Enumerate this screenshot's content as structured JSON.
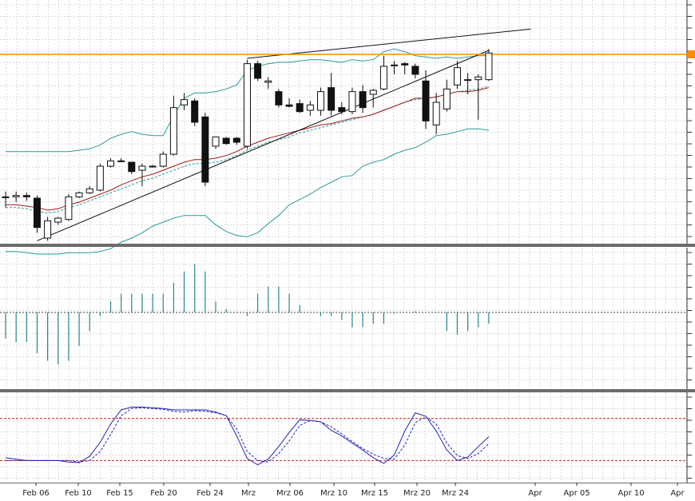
{
  "chart_data": [
    {
      "type": "candlestick",
      "panel": "price",
      "grid": true,
      "candles": [
        {
          "date": "Feb 01",
          "o": 0.474,
          "h": 0.478,
          "l": 0.466,
          "c": 0.474
        },
        {
          "date": "Feb 02",
          "o": 0.474,
          "h": 0.478,
          "l": 0.47,
          "c": 0.475
        },
        {
          "date": "Feb 03",
          "o": 0.475,
          "h": 0.477,
          "l": 0.471,
          "c": 0.474
        },
        {
          "date": "Feb 06",
          "o": 0.473,
          "h": 0.475,
          "l": 0.447,
          "c": 0.451
        },
        {
          "date": "Feb 07",
          "o": 0.443,
          "h": 0.459,
          "l": 0.441,
          "c": 0.456
        },
        {
          "date": "Feb 08",
          "o": 0.455,
          "h": 0.459,
          "l": 0.453,
          "c": 0.458
        },
        {
          "date": "Feb 09",
          "o": 0.457,
          "h": 0.476,
          "l": 0.456,
          "c": 0.474
        },
        {
          "date": "Feb 10",
          "o": 0.474,
          "h": 0.478,
          "l": 0.473,
          "c": 0.477
        },
        {
          "date": "Feb 13",
          "o": 0.477,
          "h": 0.482,
          "l": 0.476,
          "c": 0.48
        },
        {
          "date": "Feb 14",
          "o": 0.479,
          "h": 0.499,
          "l": 0.478,
          "c": 0.497
        },
        {
          "date": "Feb 15",
          "o": 0.497,
          "h": 0.503,
          "l": 0.496,
          "c": 0.501
        },
        {
          "date": "Feb 16",
          "o": 0.501,
          "h": 0.503,
          "l": 0.5,
          "c": 0.501
        },
        {
          "date": "Feb 17",
          "o": 0.5,
          "h": 0.5,
          "l": 0.491,
          "c": 0.493
        },
        {
          "date": "Feb 18",
          "o": 0.494,
          "h": 0.499,
          "l": 0.482,
          "c": 0.497
        },
        {
          "date": "Feb 19",
          "o": 0.497,
          "h": 0.498,
          "l": 0.496,
          "c": 0.497
        },
        {
          "date": "Feb 20",
          "o": 0.497,
          "h": 0.508,
          "l": 0.496,
          "c": 0.506
        },
        {
          "date": "Feb 21",
          "o": 0.506,
          "h": 0.55,
          "l": 0.505,
          "c": 0.541
        },
        {
          "date": "Feb 22",
          "o": 0.543,
          "h": 0.552,
          "l": 0.539,
          "c": 0.547
        },
        {
          "date": "Feb 23",
          "o": 0.546,
          "h": 0.548,
          "l": 0.527,
          "c": 0.53
        },
        {
          "date": "Feb 24",
          "o": 0.534,
          "h": 0.537,
          "l": 0.482,
          "c": 0.485
        },
        {
          "date": "Feb 27",
          "o": 0.512,
          "h": 0.519,
          "l": 0.51,
          "c": 0.519
        },
        {
          "date": "Feb 28",
          "o": 0.518,
          "h": 0.519,
          "l": 0.513,
          "c": 0.514
        },
        {
          "date": "Feb 29",
          "o": 0.518,
          "h": 0.519,
          "l": 0.513,
          "c": 0.515
        },
        {
          "date": "Mrz 01",
          "o": 0.512,
          "h": 0.577,
          "l": 0.51,
          "c": 0.574
        },
        {
          "date": "Mrz 02",
          "o": 0.574,
          "h": 0.576,
          "l": 0.561,
          "c": 0.563
        },
        {
          "date": "Mrz 05",
          "o": 0.56,
          "h": 0.564,
          "l": 0.555,
          "c": 0.561
        },
        {
          "date": "Mrz 06",
          "o": 0.553,
          "h": 0.555,
          "l": 0.541,
          "c": 0.543
        },
        {
          "date": "Mrz 07",
          "o": 0.543,
          "h": 0.548,
          "l": 0.541,
          "c": 0.542
        },
        {
          "date": "Mrz 08",
          "o": 0.544,
          "h": 0.547,
          "l": 0.537,
          "c": 0.538
        },
        {
          "date": "Mrz 09",
          "o": 0.539,
          "h": 0.546,
          "l": 0.535,
          "c": 0.543
        },
        {
          "date": "Mrz 12",
          "o": 0.539,
          "h": 0.556,
          "l": 0.535,
          "c": 0.553
        },
        {
          "date": "Mrz 13",
          "o": 0.556,
          "h": 0.567,
          "l": 0.535,
          "c": 0.539
        },
        {
          "date": "Mrz 14",
          "o": 0.541,
          "h": 0.545,
          "l": 0.536,
          "c": 0.538
        },
        {
          "date": "Mrz 15",
          "o": 0.538,
          "h": 0.556,
          "l": 0.536,
          "c": 0.553
        },
        {
          "date": "Mrz 16",
          "o": 0.553,
          "h": 0.558,
          "l": 0.537,
          "c": 0.541
        },
        {
          "date": "Mrz 19",
          "o": 0.551,
          "h": 0.555,
          "l": 0.541,
          "c": 0.554
        },
        {
          "date": "Mrz 20",
          "o": 0.555,
          "h": 0.58,
          "l": 0.554,
          "c": 0.572
        },
        {
          "date": "Mrz 21",
          "o": 0.573,
          "h": 0.576,
          "l": 0.566,
          "c": 0.573
        },
        {
          "date": "Mrz 22",
          "o": 0.574,
          "h": 0.575,
          "l": 0.566,
          "c": 0.573
        },
        {
          "date": "Mrz 23",
          "o": 0.572,
          "h": 0.574,
          "l": 0.563,
          "c": 0.566
        },
        {
          "date": "Mrz 26",
          "o": 0.561,
          "h": 0.569,
          "l": 0.525,
          "c": 0.531
        },
        {
          "date": "Mrz 27",
          "o": 0.528,
          "h": 0.552,
          "l": 0.521,
          "c": 0.545
        },
        {
          "date": "Mrz 28",
          "o": 0.54,
          "h": 0.562,
          "l": 0.538,
          "c": 0.555
        },
        {
          "date": "Mrz 29",
          "o": 0.558,
          "h": 0.576,
          "l": 0.555,
          "c": 0.571
        },
        {
          "date": "Mrz 30",
          "o": 0.562,
          "h": 0.567,
          "l": 0.551,
          "c": 0.562
        },
        {
          "date": "Apr 02",
          "o": 0.562,
          "h": 0.566,
          "l": 0.532,
          "c": 0.564
        },
        {
          "date": "Apr 03",
          "o": 0.562,
          "h": 0.585,
          "l": 0.561,
          "c": 0.582
        }
      ],
      "moving_average_red": [
        0.468,
        0.468,
        0.467,
        0.466,
        0.464,
        0.465,
        0.468,
        0.47,
        0.473,
        0.476,
        0.479,
        0.483,
        0.486,
        0.489,
        0.491,
        0.494,
        0.497,
        0.5,
        0.502,
        0.502,
        0.503,
        0.505,
        0.508,
        0.512,
        0.515,
        0.518,
        0.52,
        0.522,
        0.524,
        0.526,
        0.528,
        0.529,
        0.531,
        0.533,
        0.534,
        0.536,
        0.539,
        0.542,
        0.545,
        0.548,
        0.548,
        0.549,
        0.551,
        0.553,
        0.553,
        0.554,
        0.556
      ],
      "moving_average_teal": [
        0.466,
        0.466,
        0.465,
        0.463,
        0.462,
        0.463,
        0.466,
        0.468,
        0.471,
        0.474,
        0.477,
        0.48,
        0.483,
        0.486,
        0.488,
        0.491,
        0.494,
        0.497,
        0.499,
        0.499,
        0.5,
        0.502,
        0.505,
        0.509,
        0.512,
        0.515,
        0.517,
        0.519,
        0.522,
        0.524,
        0.526,
        0.528,
        0.53,
        0.532,
        0.534,
        0.536,
        0.539,
        0.542,
        0.545,
        0.547,
        0.548,
        0.549,
        0.551,
        0.553,
        0.554,
        0.555,
        0.557
      ],
      "bollinger_upper": [
        0.508,
        0.508,
        0.508,
        0.508,
        0.508,
        0.508,
        0.508,
        0.509,
        0.51,
        0.513,
        0.518,
        0.521,
        0.523,
        0.521,
        0.52,
        0.52,
        0.535,
        0.548,
        0.552,
        0.552,
        0.553,
        0.555,
        0.558,
        0.569,
        0.572,
        0.574,
        0.575,
        0.575,
        0.576,
        0.577,
        0.577,
        0.576,
        0.575,
        0.577,
        0.576,
        0.577,
        0.583,
        0.585,
        0.583,
        0.58,
        0.579,
        0.578,
        0.579,
        0.578,
        0.579,
        0.58,
        0.58
      ],
      "bollinger_lower": [
        0.433,
        0.433,
        0.432,
        0.431,
        0.431,
        0.431,
        0.432,
        0.432,
        0.432,
        0.433,
        0.435,
        0.44,
        0.443,
        0.447,
        0.452,
        0.455,
        0.458,
        0.46,
        0.46,
        0.46,
        0.453,
        0.448,
        0.445,
        0.444,
        0.447,
        0.454,
        0.46,
        0.468,
        0.472,
        0.476,
        0.481,
        0.485,
        0.489,
        0.49,
        0.497,
        0.5,
        0.502,
        0.506,
        0.509,
        0.511,
        0.515,
        0.52,
        0.521,
        0.523,
        0.525,
        0.525,
        0.524
      ],
      "trendlines": [
        {
          "name": "support",
          "x1": "Feb 06",
          "y1": 0.441,
          "x2": "Apr 03",
          "y2": 0.584
        },
        {
          "name": "resistance",
          "x1": "Mrz 01",
          "y1": 0.578,
          "x2": "Apr 08",
          "y2": 0.6
        }
      ],
      "horizontal_line": {
        "value": 0.581,
        "color": "#ff8c00"
      }
    },
    {
      "type": "histogram",
      "panel": "oscillator",
      "zero_line": true,
      "values": [
        -0.007,
        -0.008,
        -0.008,
        -0.011,
        -0.013,
        -0.014,
        -0.013,
        -0.009,
        -0.005,
        -0.001,
        0.003,
        0.005,
        0.005,
        0.005,
        0.005,
        0.005,
        0.008,
        0.011,
        0.013,
        0.011,
        0.003,
        0.001,
        -0.0001,
        -0.001,
        0.005,
        0.007,
        0.007,
        0.005,
        0.002,
        0,
        -0.001,
        -0.001,
        -0.002,
        -0.004,
        -0.004,
        -0.003,
        -0.003,
        -0.0003,
        0,
        0.0003,
        0.0001,
        -0.0001,
        -0.005,
        -0.006,
        -0.005,
        -0.004,
        -0.003
      ]
    },
    {
      "type": "line",
      "panel": "stochastic",
      "levels": [
        80,
        20
      ],
      "ylim": [
        0,
        100
      ],
      "series": [
        {
          "color": "#2424b8",
          "style": "solid",
          "values": [
            24,
            22,
            20,
            20,
            20,
            20,
            18,
            17,
            26,
            46,
            72,
            92,
            96,
            96,
            95,
            94,
            92,
            92,
            92,
            92,
            89,
            84,
            55,
            23,
            14,
            22,
            40,
            60,
            78,
            77,
            75,
            63,
            55,
            45,
            35,
            24,
            16,
            28,
            62,
            88,
            83,
            62,
            35,
            20,
            25,
            40,
            54
          ]
        },
        {
          "color": "#2424b8",
          "style": "dashed",
          "values": [
            20,
            20,
            20,
            20,
            20,
            20,
            20,
            18,
            20,
            33,
            57,
            84,
            94,
            95,
            94,
            93,
            90,
            89,
            91,
            90,
            88,
            84,
            65,
            33,
            20,
            18,
            30,
            48,
            70,
            77,
            75,
            68,
            58,
            47,
            37,
            29,
            23,
            22,
            42,
            74,
            82,
            72,
            45,
            27,
            23,
            30,
            44
          ]
        }
      ]
    },
    {
      "type": "axis",
      "tick_labels": [
        "Feb 06",
        "Feb 10",
        "Feb 15",
        "Feb 20",
        "Feb 24",
        "Mrz",
        "Mrz 06",
        "Mrz 10",
        "Mrz 15",
        "Mrz 20",
        "Mrz 24",
        "Apr",
        "Apr 05",
        "Apr 10",
        "Apr"
      ]
    }
  ]
}
